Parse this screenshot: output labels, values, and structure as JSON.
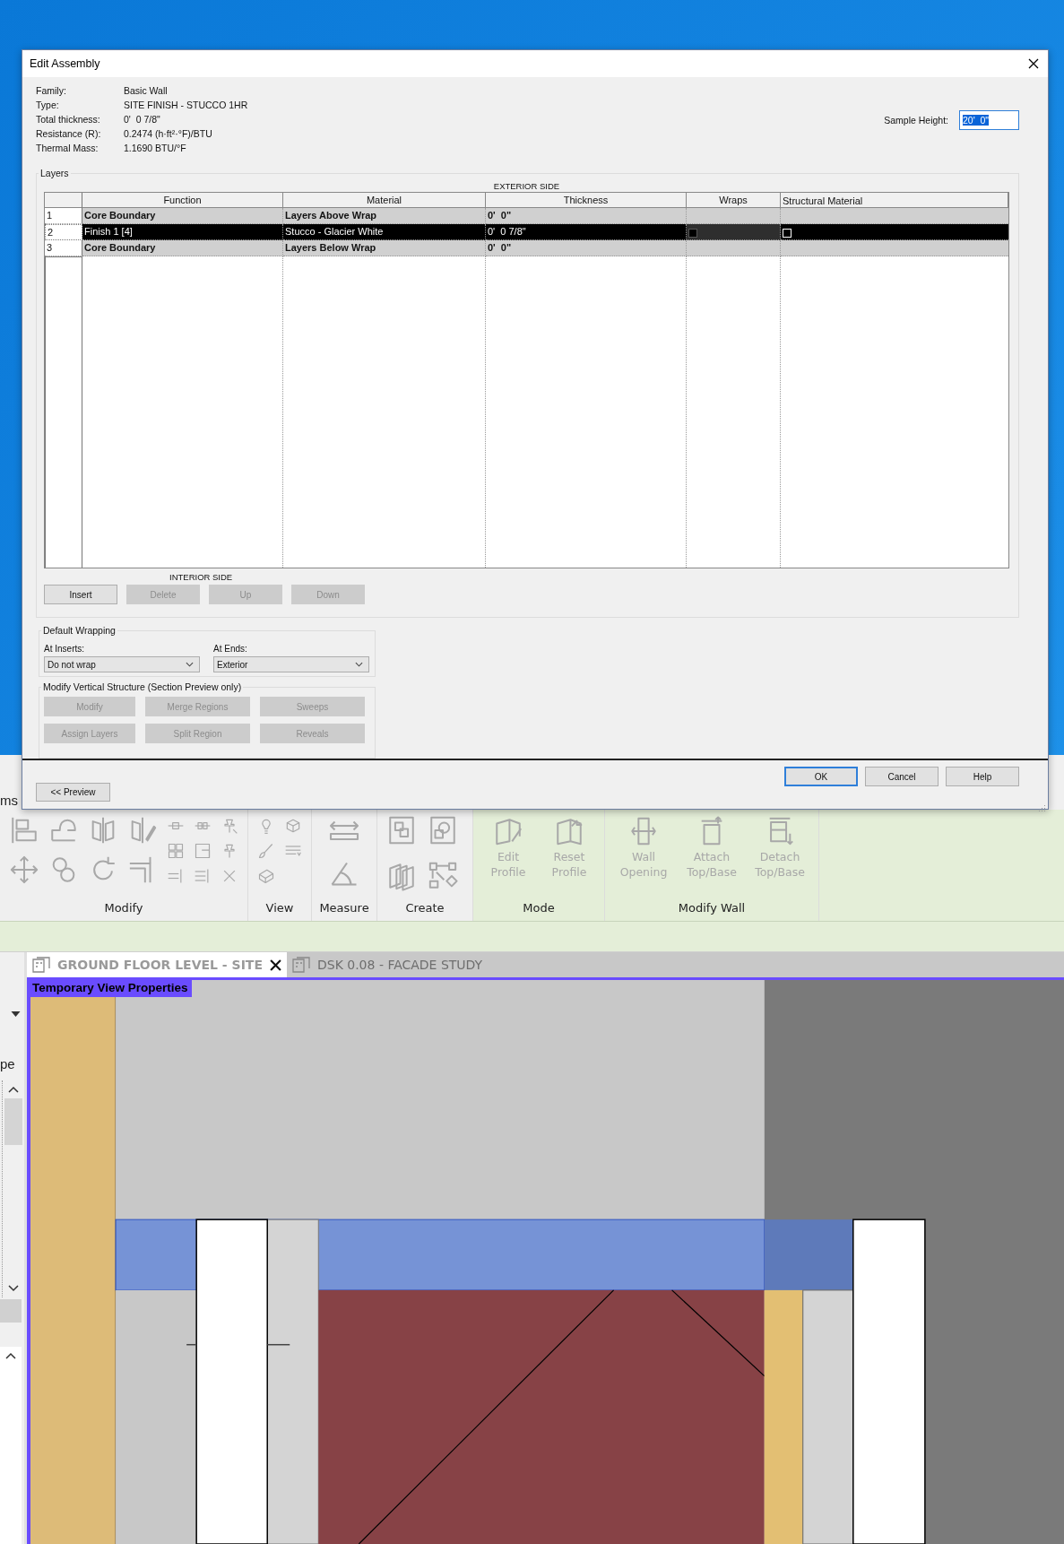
{
  "dialog": {
    "title": "Edit Assembly",
    "properties": [
      {
        "label": "Family:",
        "value": "Basic Wall"
      },
      {
        "label": "Type:",
        "value": "SITE FINISH - STUCCO 1HR"
      },
      {
        "label": "Total thickness:",
        "value": "0'  0 7/8\""
      },
      {
        "label": "Resistance (R):",
        "value": "0.2474 (h·ft²·°F)/BTU"
      },
      {
        "label": "Thermal Mass:",
        "value": "1.1690 BTU/°F"
      }
    ],
    "sample_height": {
      "label": "Sample Height:",
      "value": "20'  0\""
    },
    "layers": {
      "title": "Layers",
      "exterior_label": "EXTERIOR SIDE",
      "interior_label": "INTERIOR SIDE",
      "columns": [
        "Function",
        "Material",
        "Thickness",
        "Wraps",
        "Structural Material"
      ],
      "rows": [
        {
          "number": "1",
          "kind": "boundary",
          "function": "Core Boundary",
          "material": "Layers Above Wrap",
          "thickness": "0'  0\"",
          "selected": false
        },
        {
          "number": "2",
          "kind": "layer",
          "function": "Finish 1 [4]",
          "material": "Stucco - Glacier White",
          "thickness": "0'  0 7/8\"",
          "wraps": true,
          "structural_material": false,
          "selected": true
        },
        {
          "number": "3",
          "kind": "boundary",
          "function": "Core Boundary",
          "material": "Layers Below Wrap",
          "thickness": "0'  0\"",
          "selected": false
        }
      ],
      "buttons": [
        {
          "label": "Insert",
          "disabled": false
        },
        {
          "label": "Delete",
          "disabled": true
        },
        {
          "label": "Up",
          "disabled": true
        },
        {
          "label": "Down",
          "disabled": true
        }
      ]
    },
    "default_wrapping": {
      "title": "Default Wrapping",
      "fields": [
        {
          "label": "At Inserts:",
          "value": "Do not wrap"
        },
        {
          "label": "At  Ends:",
          "value": "Exterior"
        }
      ]
    },
    "vertical_structure": {
      "title": "Modify Vertical Structure (Section Preview only)",
      "buttons": [
        {
          "label": "Modify",
          "disabled": true
        },
        {
          "label": "Merge Regions",
          "disabled": true
        },
        {
          "label": "Sweeps",
          "disabled": true
        },
        {
          "label": "Assign Layers",
          "disabled": true
        },
        {
          "label": "Split Region",
          "disabled": true
        },
        {
          "label": "Reveals",
          "disabled": true
        }
      ]
    },
    "preview_button": "<< Preview",
    "footer_buttons": [
      {
        "label": "OK",
        "default": true
      },
      {
        "label": "Cancel",
        "default": false
      },
      {
        "label": "Help",
        "default": false
      }
    ]
  },
  "app": {
    "left_panel": {
      "toolbar_text": "ms",
      "properties_text": "pe"
    },
    "ribbon": {
      "panels": [
        {
          "title": "Modify",
          "kind": "modify",
          "contextual": false
        },
        {
          "title": "View",
          "kind": "view",
          "contextual": false
        },
        {
          "title": "Measure",
          "kind": "measure",
          "contextual": false
        },
        {
          "title": "Create",
          "kind": "create",
          "contextual": false
        },
        {
          "title": "Mode",
          "kind": "tools",
          "contextual": true,
          "tools": [
            {
              "label": "Edit Profile",
              "disabled": true
            },
            {
              "label": "Reset Profile",
              "disabled": true
            }
          ]
        },
        {
          "title": "Modify Wall",
          "kind": "tools",
          "contextual": true,
          "tools": [
            {
              "label": "Wall Opening",
              "disabled": true
            },
            {
              "label": "Attach Top/Base",
              "disabled": true
            },
            {
              "label": "Detach Top/Base",
              "disabled": true
            }
          ]
        }
      ]
    },
    "view_tabs": [
      {
        "label": "GROUND FLOOR LEVEL - SITE",
        "selected": true
      },
      {
        "label": "DSK 0.08 - FACADE STUDY",
        "selected": false
      }
    ],
    "view": {
      "banner": "Temporary View Properties"
    }
  }
}
